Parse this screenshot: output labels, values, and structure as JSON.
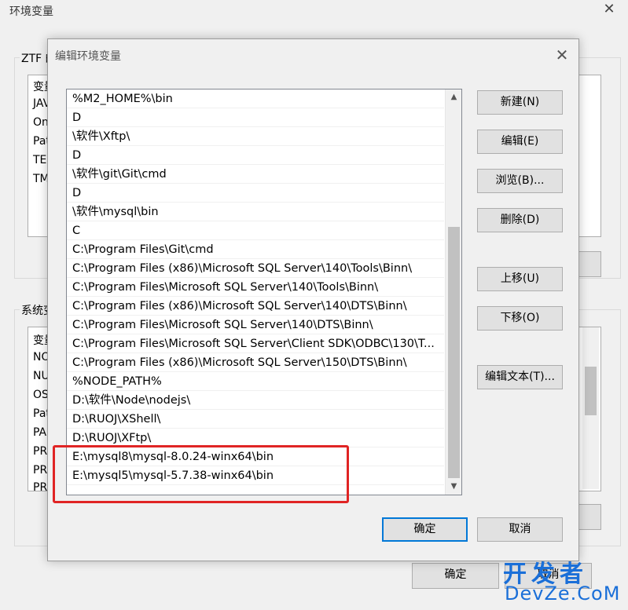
{
  "background_window": {
    "title": "环境变量",
    "user_group_label": "ZTF 的",
    "user_list_items": [
      "变量",
      "JAVA",
      "One",
      "Path",
      "TEMP",
      "TMP"
    ],
    "system_group_label": "系统变量",
    "system_list_items": [
      "变量",
      "NO",
      "NU",
      "OS",
      "Path",
      "PA",
      "PR",
      "PR",
      "PR"
    ],
    "ok_label": "确定",
    "cancel_label": "取消"
  },
  "dialog": {
    "title": "编辑环境变量",
    "path_entries": [
      "%M2_HOME%\\bin",
      "D",
      "\\软件\\Xftp\\",
      "D",
      "\\软件\\git\\Git\\cmd",
      "D",
      "\\软件\\mysql\\bin",
      "C",
      "C:\\Program Files\\Git\\cmd",
      "C:\\Program Files (x86)\\Microsoft SQL Server\\140\\Tools\\Binn\\",
      "C:\\Program Files\\Microsoft SQL Server\\140\\Tools\\Binn\\",
      "C:\\Program Files (x86)\\Microsoft SQL Server\\140\\DTS\\Binn\\",
      "C:\\Program Files\\Microsoft SQL Server\\140\\DTS\\Binn\\",
      "C:\\Program Files\\Microsoft SQL Server\\Client SDK\\ODBC\\130\\T...",
      "C:\\Program Files (x86)\\Microsoft SQL Server\\150\\DTS\\Binn\\",
      "%NODE_PATH%",
      "D:\\软件\\Node\\nodejs\\",
      "D:\\RUOJ\\XShell\\",
      "D:\\RUOJ\\XFtp\\",
      "E:\\mysql8\\mysql-8.0.24-winx64\\bin",
      "E:\\mysql5\\mysql-5.7.38-winx64\\bin"
    ],
    "buttons": {
      "new": "新建(N)",
      "edit": "编辑(E)",
      "browse": "浏览(B)...",
      "delete": "删除(D)",
      "move_up": "上移(U)",
      "move_down": "下移(O)",
      "edit_text": "编辑文本(T)...",
      "ok": "确定",
      "cancel": "取消"
    }
  },
  "watermark": {
    "line1": "开发者",
    "line2": "DevZe.CoM"
  },
  "colors": {
    "highlight": "#e02424",
    "watermark": "#1a6fd8"
  }
}
